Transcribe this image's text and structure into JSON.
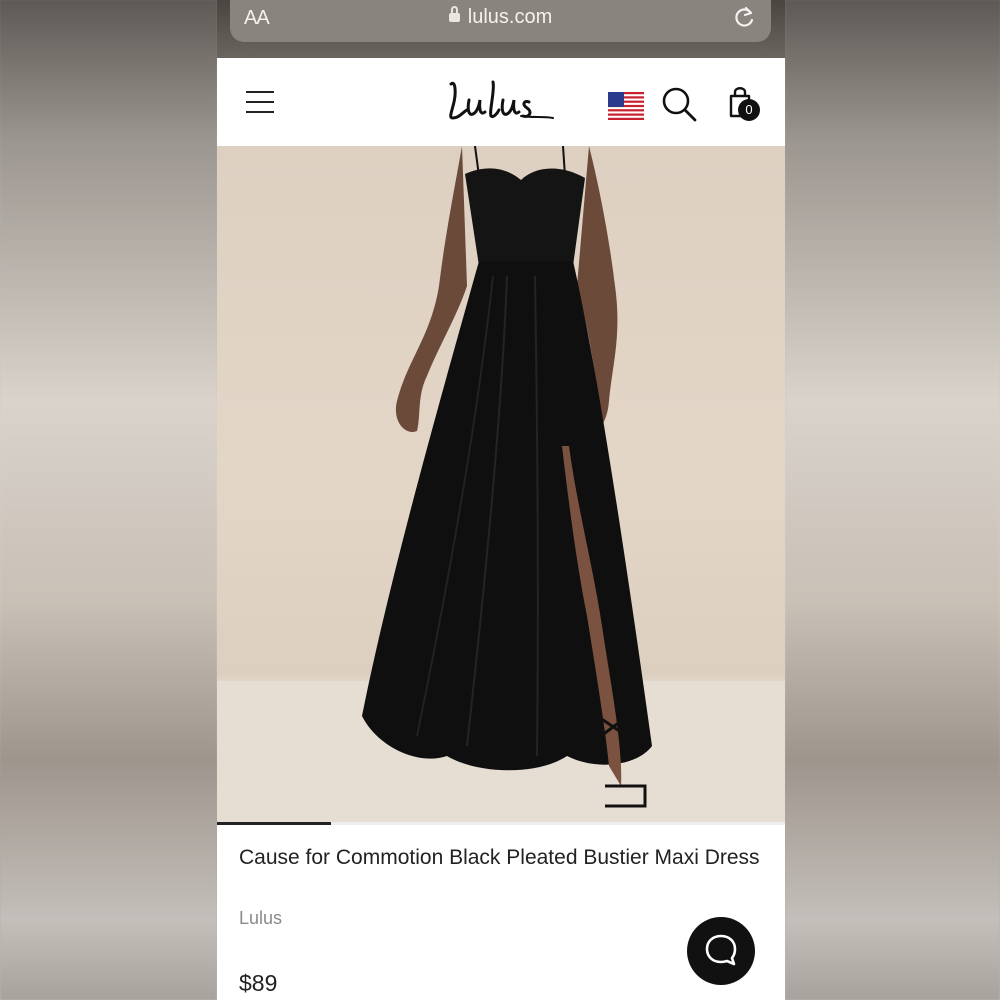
{
  "browser": {
    "text_size_label": "AA",
    "url": "lulus.com"
  },
  "header": {
    "logo_text": "Lulus",
    "cart_count": "0",
    "icons": [
      "menu-icon",
      "us-flag-icon",
      "search-icon",
      "shopping-bag-icon"
    ]
  },
  "gallery": {
    "progress": 0.2
  },
  "product": {
    "title": "Cause for Commotion Black Pleated Bustier Maxi Dress",
    "brand": "Lulus",
    "price": "$89"
  },
  "chat": {
    "icon": "chat-bubble-icon"
  },
  "colors": {
    "accent": "#111111",
    "muted_text": "#8a8a8a"
  }
}
